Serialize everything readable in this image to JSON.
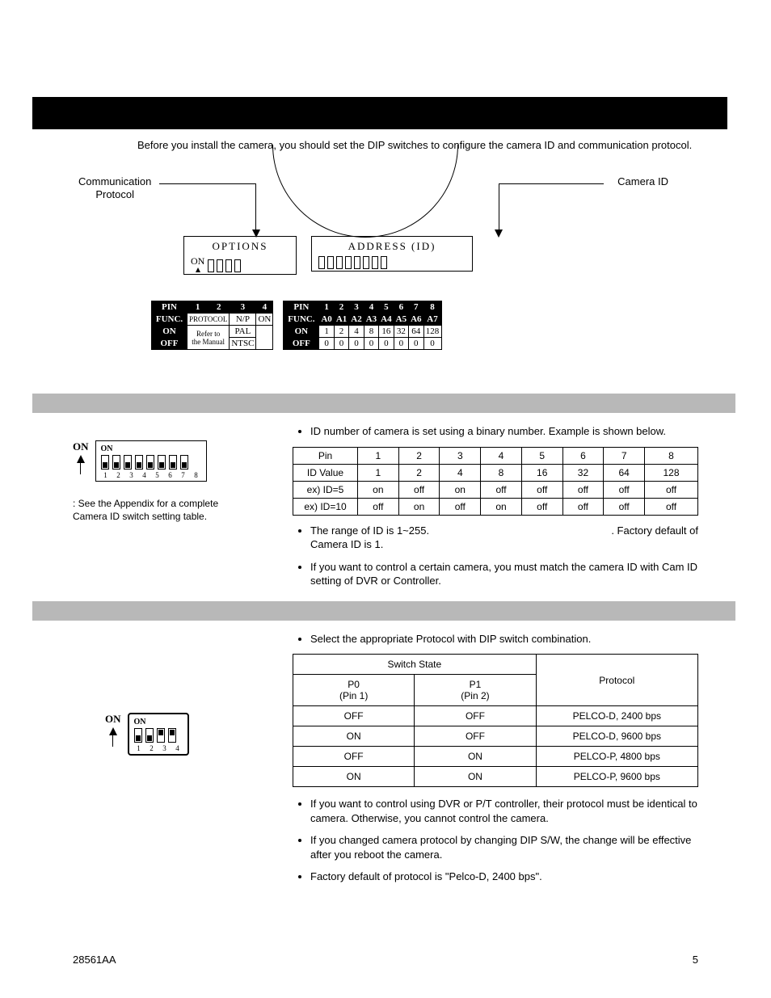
{
  "intro": "Before you install the camera, you should set the DIP switches to configure the camera ID and communication protocol.",
  "diagram": {
    "label_comm_l1": "Communication",
    "label_comm_l2": "Protocol",
    "label_camid": "Camera ID",
    "options_title": "OPTIONS",
    "address_title": "ADDRESS (ID)",
    "on_label": "ON"
  },
  "ref_left": {
    "r0": [
      "PIN",
      "1",
      "2",
      "3",
      "4"
    ],
    "r1": [
      "FUNC.",
      "PROTOCOL",
      "N/P",
      "ON"
    ],
    "r2": [
      "ON",
      "Refer to",
      "PAL",
      ""
    ],
    "r3": [
      "OFF",
      "the Manual",
      "NTSC",
      ""
    ]
  },
  "ref_right": {
    "r0": [
      "PIN",
      "1",
      "2",
      "3",
      "4",
      "5",
      "6",
      "7",
      "8"
    ],
    "r1": [
      "FUNC.",
      "A0",
      "A1",
      "A2",
      "A3",
      "A4",
      "A5",
      "A6",
      "A7"
    ],
    "r2": [
      "ON",
      "1",
      "2",
      "4",
      "8",
      "16",
      "32",
      "64",
      "128"
    ],
    "r3": [
      "OFF",
      "0",
      "0",
      "0",
      "0",
      "0",
      "0",
      "0",
      "0"
    ]
  },
  "section1": {
    "bullet1": "ID number of camera is set using a binary number. Example is shown below.",
    "table": {
      "headers": [
        "Pin",
        "1",
        "2",
        "3",
        "4",
        "5",
        "6",
        "7",
        "8"
      ],
      "rows": [
        [
          "ID Value",
          "1",
          "2",
          "4",
          "8",
          "16",
          "32",
          "64",
          "128"
        ],
        [
          "ex) ID=5",
          "on",
          "off",
          "on",
          "off",
          "off",
          "off",
          "off",
          "off"
        ],
        [
          "ex) ID=10",
          "off",
          "on",
          "off",
          "on",
          "off",
          "off",
          "off",
          "off"
        ]
      ]
    },
    "bullet2_a": "The range of ID is 1~255.",
    "bullet2_b": ". Factory default of Camera ID is 1.",
    "bullet3": "If you want to control a certain camera, you must match the camera ID with Cam ID setting of DVR or Controller.",
    "appendix_line1": ": See the Appendix for a complete",
    "appendix_line2": "Camera ID switch setting table.",
    "on_label": "ON",
    "intitle": "ON",
    "nums": [
      "1",
      "2",
      "3",
      "4",
      "5",
      "6",
      "7",
      "8"
    ]
  },
  "section2": {
    "bullet1": "Select the appropriate Protocol with DIP switch combination.",
    "table": {
      "h_switch": "Switch State",
      "h_proto": "Protocol",
      "h_p0_a": "P0",
      "h_p0_b": "(Pin 1)",
      "h_p1_a": "P1",
      "h_p1_b": "(Pin 2)",
      "rows": [
        [
          "OFF",
          "OFF",
          "PELCO-D, 2400 bps"
        ],
        [
          "ON",
          "OFF",
          "PELCO-D, 9600 bps"
        ],
        [
          "OFF",
          "ON",
          "PELCO-P, 4800 bps"
        ],
        [
          "ON",
          "ON",
          "PELCO-P, 9600 bps"
        ]
      ]
    },
    "bullet2": "If you want to control using DVR or P/T controller, their protocol must be identical to camera. Otherwise, you cannot control the camera.",
    "bullet3": "If you changed camera protocol by changing DIP S/W, the change will be effective after you reboot the camera.",
    "bullet4": "Factory default of protocol is \"Pelco-D, 2400 bps\".",
    "on_label": "ON",
    "intitle": "ON",
    "nums": [
      "1",
      "2",
      "3",
      "4"
    ]
  },
  "footer": {
    "left": "28561AA",
    "right": "5"
  }
}
